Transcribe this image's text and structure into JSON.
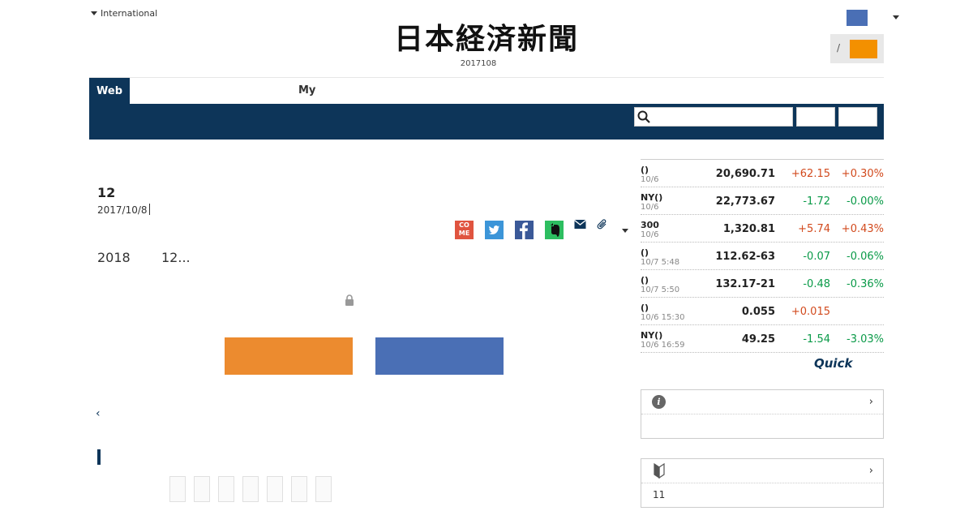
{
  "header": {
    "edition_label": "International",
    "masthead": "日本経済新聞",
    "date": "2017108",
    "login_separator": "/"
  },
  "colors": {
    "navy": "#0d3559",
    "orange": "#ec8b2f",
    "blue": "#4a6fb5",
    "up": "#d24a1d",
    "down": "#0a9a48"
  },
  "tabs": {
    "web": "Web",
    "my": "My"
  },
  "search": {
    "placeholder": ""
  },
  "article": {
    "title": "12",
    "date": "2017/10/8",
    "lead": [
      "2018",
      "12..."
    ],
    "share_icons": [
      "comment-icon",
      "twitter-icon",
      "facebook-icon",
      "evernote-icon",
      "mail-icon",
      "clip-icon"
    ],
    "comment_label": "CO ME"
  },
  "markets": [
    {
      "name": "()",
      "time": "10/6",
      "value": "20,690.71",
      "change": "+62.15",
      "pct": "+0.30%",
      "dir": "up"
    },
    {
      "name": "NY()",
      "time": "10/6",
      "value": "22,773.67",
      "change": "-1.72",
      "pct": "-0.00%",
      "dir": "down"
    },
    {
      "name": "300",
      "time": "10/6",
      "value": "1,320.81",
      "change": "+5.74",
      "pct": "+0.43%",
      "dir": "up"
    },
    {
      "name": "()",
      "time": "10/7 5:48",
      "value": "112.62-63",
      "change": "-0.07",
      "pct": "-0.06%",
      "dir": "down"
    },
    {
      "name": "()",
      "time": "10/7 5:50",
      "value": "132.17-21",
      "change": "-0.48",
      "pct": "-0.36%",
      "dir": "down"
    },
    {
      "name": "()",
      "time": "10/6 15:30",
      "value": "0.055",
      "change": "+0.015",
      "pct": "",
      "dir": "up"
    },
    {
      "name": "NY()",
      "time": "10/6 16:59",
      "value": "49.25",
      "change": "-1.54",
      "pct": "-3.03%",
      "dir": "down"
    }
  ],
  "quick_logo": "Quick",
  "panels": {
    "info": {
      "chevron": "›",
      "text": ""
    },
    "beginner": {
      "chevron": "›",
      "text": "11"
    }
  },
  "nav": {
    "back": "‹"
  }
}
